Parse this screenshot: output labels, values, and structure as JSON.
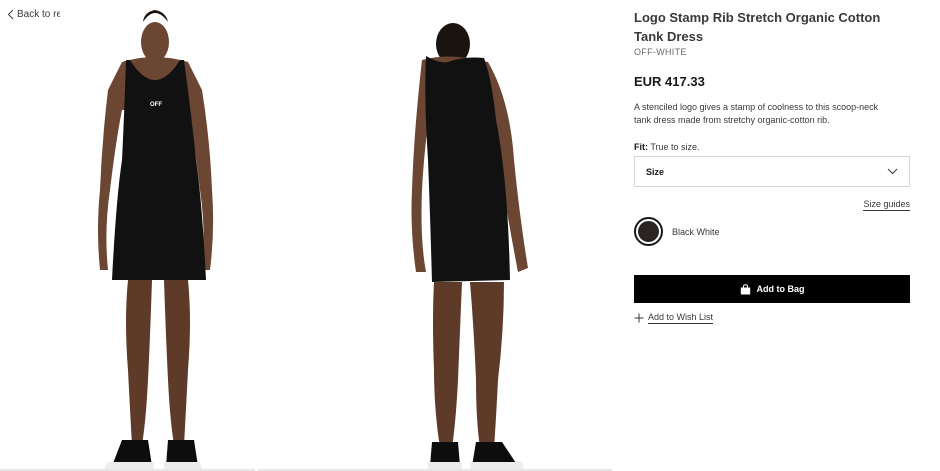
{
  "nav": {
    "back_label": "Back to results"
  },
  "product": {
    "title": "Logo Stamp Rib Stretch Organic Cotton Tank Dress",
    "brand": "OFF-WHITE",
    "price": "EUR 417.33",
    "description": "A stenciled logo gives a stamp of coolness to this scoop-neck tank dress made from stretchy organic-cotton rib.",
    "fit_label": "Fit:",
    "fit_value": "True to size.",
    "logo_text": "OFF"
  },
  "size": {
    "selected_label": "Size",
    "guides_label": "Size guides"
  },
  "color": {
    "selected_name": "Black White",
    "swatch_hex": "#2a2424"
  },
  "actions": {
    "add_to_bag_label": "Add to Bag",
    "wishlist_label": "Add to Wish List"
  },
  "icons": {
    "back": "chevron-left-icon",
    "select": "chevron-down-icon",
    "bag": "shopping-bag-icon",
    "wishlist": "plus-icon"
  },
  "colors": {
    "button_bg": "#000000",
    "text_primary": "#191919",
    "text_secondary": "#393939",
    "border": "#d5d5d5"
  }
}
